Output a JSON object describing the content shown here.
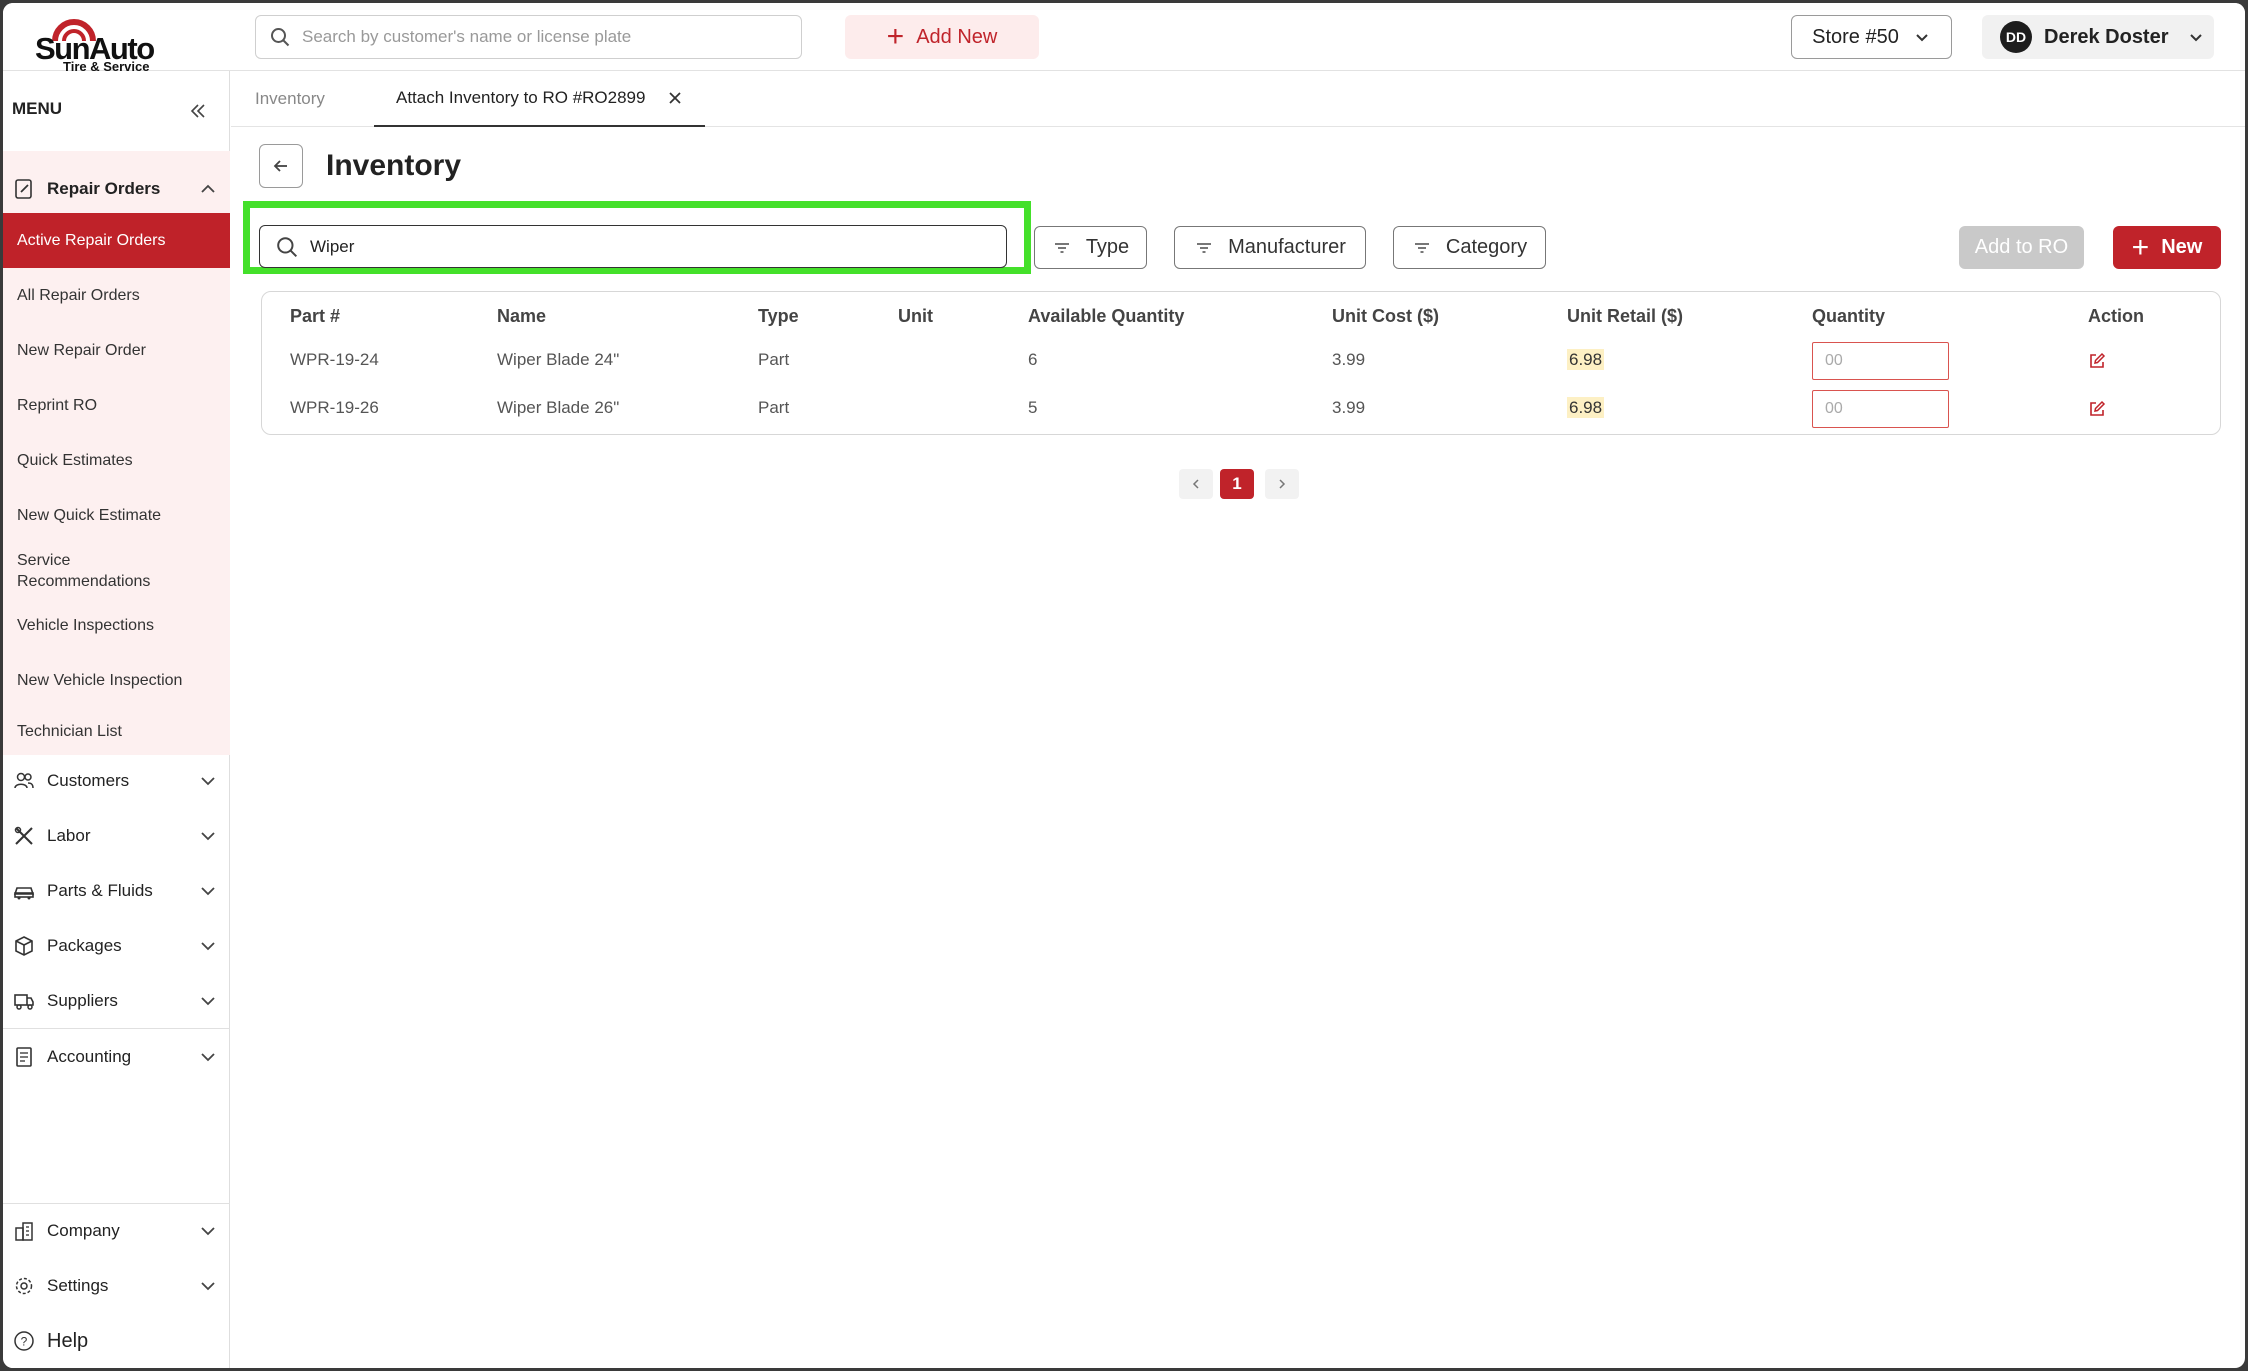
{
  "header": {
    "logo_name": "SunAuto",
    "logo_sub": "Tire & Service",
    "search_placeholder": "Search by customer's name or license plate",
    "add_new_label": "Add New",
    "store_label": "Store #50",
    "user_initials": "DD",
    "user_name": "Derek Doster"
  },
  "sidebar": {
    "menu_label": "MENU",
    "repair_orders": {
      "label": "Repair Orders",
      "items": [
        {
          "label": "Active Repair Orders",
          "active": true
        },
        {
          "label": "All Repair Orders"
        },
        {
          "label": "New Repair Order"
        },
        {
          "label": "Reprint RO"
        },
        {
          "label": "Quick Estimates"
        },
        {
          "label": "New Quick Estimate"
        },
        {
          "label": "Service Recommendations"
        },
        {
          "label": "Vehicle Inspections"
        },
        {
          "label": "New Vehicle Inspection"
        },
        {
          "label": "Technician List"
        }
      ]
    },
    "sections": [
      {
        "label": "Customers",
        "icon": "users-icon"
      },
      {
        "label": "Labor",
        "icon": "tools-icon"
      },
      {
        "label": "Parts & Fluids",
        "icon": "car-icon"
      },
      {
        "label": "Packages",
        "icon": "box-icon"
      },
      {
        "label": "Suppliers",
        "icon": "truck-icon"
      },
      {
        "label": "Accounting",
        "icon": "document-icon"
      }
    ],
    "bottom": [
      {
        "label": "Company",
        "icon": "building-icon"
      },
      {
        "label": "Settings",
        "icon": "gear-icon"
      }
    ],
    "help_label": "Help"
  },
  "tabs": [
    {
      "label": "Inventory",
      "active": false
    },
    {
      "label": "Attach Inventory to RO #RO2899",
      "active": true
    }
  ],
  "page": {
    "title": "Inventory",
    "search_value": "Wiper",
    "filters": [
      "Type",
      "Manufacturer",
      "Category"
    ],
    "add_to_ro_label": "Add to RO",
    "new_label": "New"
  },
  "table": {
    "columns": [
      "Part #",
      "Name",
      "Type",
      "Unit",
      "Available Quantity",
      "Unit Cost ($)",
      "Unit Retail ($)",
      "Quantity",
      "Action"
    ],
    "rows": [
      {
        "part": "WPR-19-24",
        "name": "Wiper Blade 24\"",
        "type": "Part",
        "unit": "",
        "available": "6",
        "cost": "3.99",
        "retail": "6.98",
        "qty_placeholder": "00"
      },
      {
        "part": "WPR-19-26",
        "name": "Wiper Blade 26\"",
        "type": "Part",
        "unit": "",
        "available": "5",
        "cost": "3.99",
        "retail": "6.98",
        "qty_placeholder": "00"
      }
    ]
  },
  "pagination": {
    "current": "1"
  },
  "colors": {
    "brand_red": "#c0232a",
    "highlight_green": "#44e02a",
    "sidebar_tint": "#fdf0f0"
  }
}
